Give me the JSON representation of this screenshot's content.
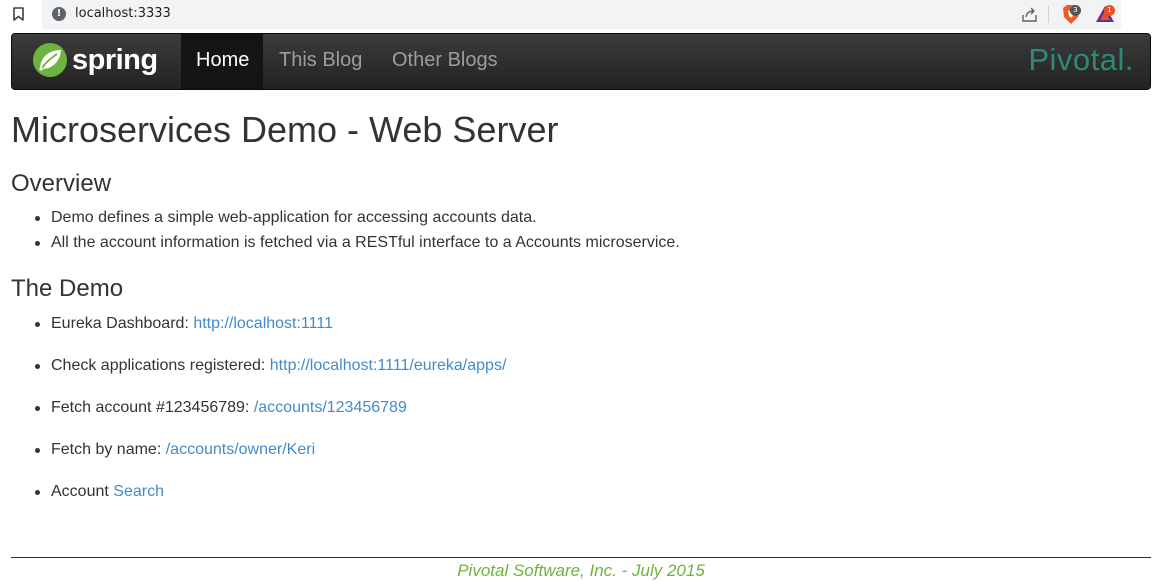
{
  "browser": {
    "url": "localhost:3333",
    "brave_badge": "3",
    "rewards_badge": "1"
  },
  "navbar": {
    "brand": "spring",
    "items": [
      {
        "label": "Home",
        "active": true
      },
      {
        "label": "This Blog",
        "active": false
      },
      {
        "label": "Other Blogs",
        "active": false
      }
    ],
    "partner_logo": "Pivotal."
  },
  "main": {
    "title": "Microservices Demo - Web Server",
    "overview": {
      "heading": "Overview",
      "items": [
        "Demo defines a simple web-application for accessing accounts data.",
        "All the account information is fetched via a RESTful interface to a Accounts microservice."
      ]
    },
    "demo": {
      "heading": "The Demo",
      "items": [
        {
          "text": "Eureka Dashboard: ",
          "link": "http://localhost:1111"
        },
        {
          "text": "Check applications registered: ",
          "link": "http://localhost:1111/eureka/apps/"
        },
        {
          "text": "Fetch account #123456789: ",
          "link": "/accounts/123456789"
        },
        {
          "text": "Fetch by name: ",
          "link": "/accounts/owner/Keri"
        },
        {
          "text": "Account ",
          "link": "Search"
        }
      ]
    }
  },
  "footer": {
    "text": "Pivotal Software, Inc. - July 2015"
  },
  "colors": {
    "link": "#428bca",
    "spring_green": "#6db33f",
    "pivotal_teal": "#2d8a76",
    "navbar_bg": "#222222"
  },
  "icons": [
    "bookmark-icon",
    "info-icon",
    "share-icon",
    "brave-shield-icon",
    "brave-rewards-icon",
    "spring-leaf-icon"
  ]
}
